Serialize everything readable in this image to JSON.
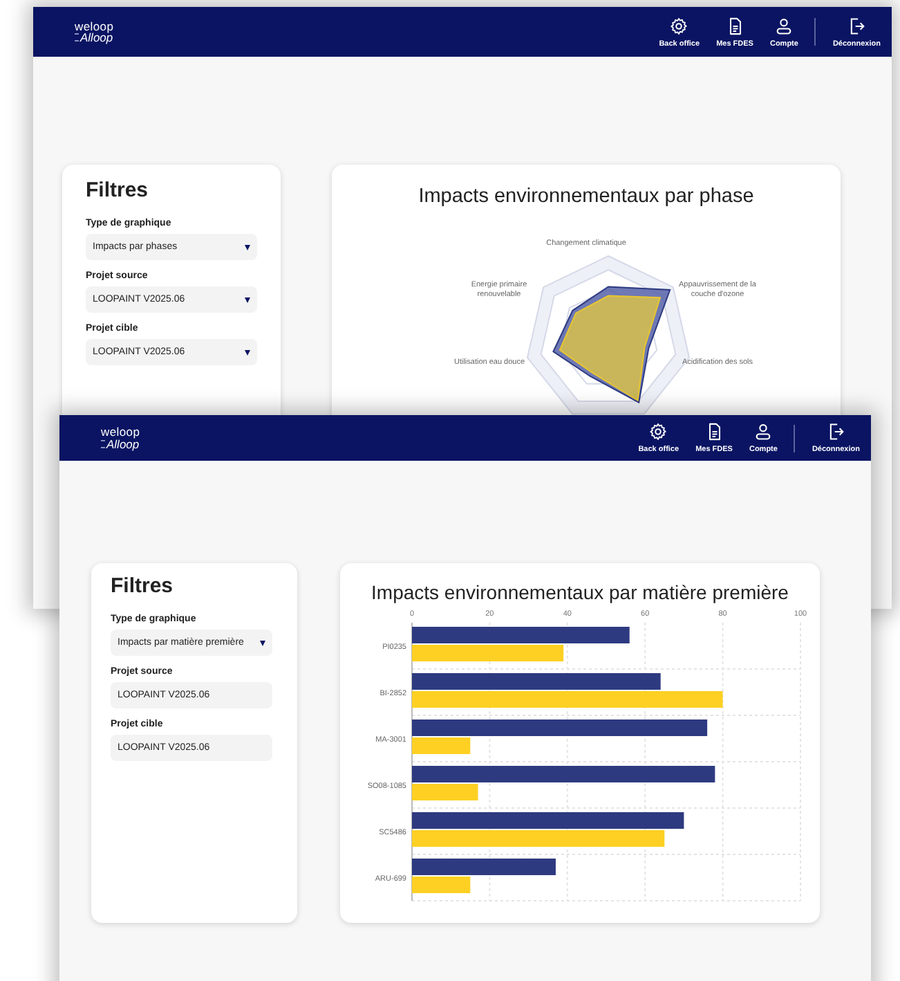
{
  "windows": [
    {
      "header": {
        "logo_top": "weloop",
        "logo_bottom": "Alloop",
        "nav": [
          {
            "label": "Back office"
          },
          {
            "label": "Mes FDES"
          },
          {
            "label": "Compte"
          },
          {
            "label": "Déconnexion"
          }
        ]
      },
      "filters": {
        "title": "Filtres",
        "fields": [
          {
            "label": "Type de graphique",
            "value": "Impacts par phases",
            "kind": "select"
          },
          {
            "label": "Projet source",
            "value": "LOOPAINT V2025.06",
            "kind": "select"
          },
          {
            "label": "Projet cible",
            "value": "LOOPAINT V2025.06",
            "kind": "select"
          }
        ]
      },
      "chart": {
        "kind": "radar",
        "title": "Impacts environnementaux par phase",
        "axis_labels": [
          "Changement climatique",
          "Energie primaire renouvelable",
          "Appauvrissement de la couche d'ozone",
          "Utilisation eau douce",
          "Acidification des sols"
        ]
      }
    },
    {
      "header": {
        "logo_top": "weloop",
        "logo_bottom": "Alloop",
        "nav": [
          {
            "label": "Back office"
          },
          {
            "label": "Mes FDES"
          },
          {
            "label": "Compte"
          },
          {
            "label": "Déconnexion"
          }
        ]
      },
      "filters": {
        "title": "Filtres",
        "fields": [
          {
            "label": "Type de graphique",
            "value": "Impacts par matière première",
            "kind": "select"
          },
          {
            "label": "Projet source",
            "value": "LOOPAINT V2025.06",
            "kind": "text"
          },
          {
            "label": "Projet cible",
            "value": "LOOPAINT V2025.06",
            "kind": "text"
          }
        ]
      },
      "chart": {
        "kind": "bar",
        "title": "Impacts environnementaux par matière première",
        "chart_data": {
          "type": "bar",
          "orientation": "horizontal",
          "categories": [
            "PI0235",
            "BI-2852",
            "MA-3001",
            "SO08-1085",
            "SC5486",
            "ARU-699"
          ],
          "series": [
            {
              "color": "#2e3a80",
              "values": [
                56,
                64,
                76,
                78,
                70,
                37
              ]
            },
            {
              "color": "#fdd023",
              "values": [
                39,
                80,
                15,
                17,
                65,
                15
              ]
            }
          ],
          "xlim": [
            0,
            100
          ],
          "xticks": [
            0,
            20,
            40,
            60,
            80,
            100
          ],
          "grid": true
        }
      }
    }
  ]
}
